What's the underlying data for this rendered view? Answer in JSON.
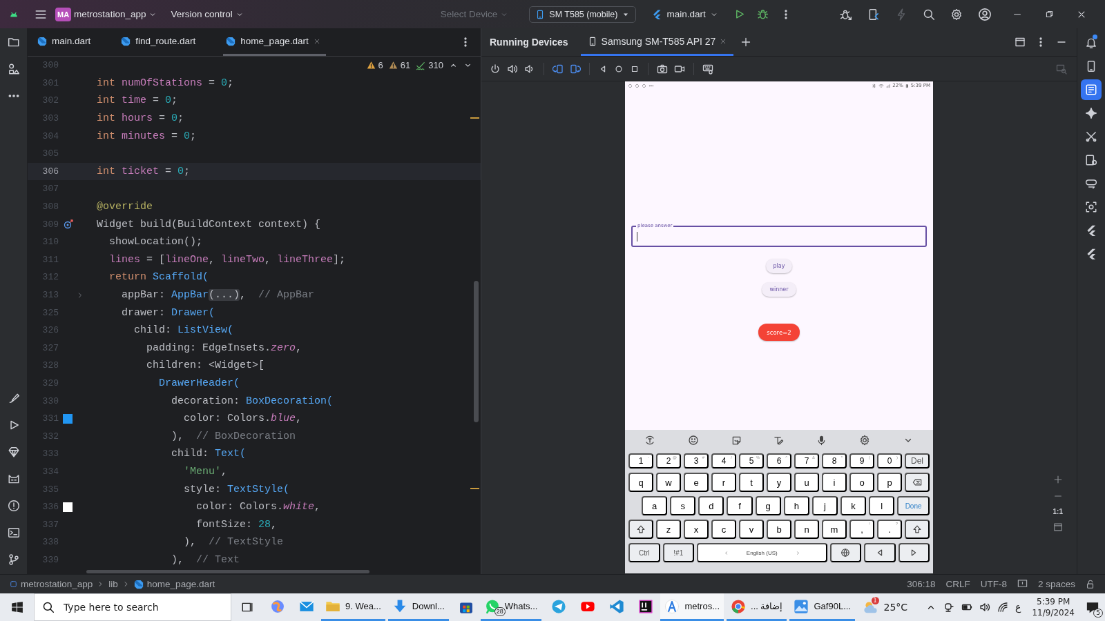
{
  "title_bar": {
    "project_badge": "MA",
    "project": "metrostation_app",
    "vcs": "Version control",
    "device_placeholder": "Select Device",
    "device": "SM T585 (mobile)",
    "run_config": "main.dart"
  },
  "editor": {
    "tabs": [
      {
        "label": "main.dart",
        "selected": false
      },
      {
        "label": "find_route.dart",
        "selected": false
      },
      {
        "label": "home_page.dart",
        "selected": true
      }
    ],
    "inspections": {
      "warnings": "6",
      "weak_warnings": "61",
      "typos": "310"
    },
    "lines": [
      {
        "number": "300",
        "kind": "plain",
        "current": false
      },
      {
        "number": "301",
        "kind": "plain",
        "current": false,
        "segments": [
          {
            "kind": "keyword",
            "text": "int"
          },
          {
            "kind": "field",
            "text": " numOfStations"
          },
          {
            "kind": "plain",
            "text": " = "
          },
          {
            "kind": "number",
            "text": "0"
          },
          {
            "kind": "plain",
            "text": ";"
          }
        ]
      },
      {
        "number": "302",
        "kind": "plain",
        "current": false,
        "segments": [
          {
            "kind": "keyword",
            "text": "int"
          },
          {
            "kind": "field",
            "text": " time"
          },
          {
            "kind": "plain",
            "text": " = "
          },
          {
            "kind": "number",
            "text": "0"
          },
          {
            "kind": "plain",
            "text": ";"
          }
        ]
      },
      {
        "number": "303",
        "kind": "plain",
        "current": false,
        "segments": [
          {
            "kind": "keyword",
            "text": "int"
          },
          {
            "kind": "field",
            "text": " hours"
          },
          {
            "kind": "plain",
            "text": " = "
          },
          {
            "kind": "number",
            "text": "0"
          },
          {
            "kind": "plain",
            "text": ";"
          }
        ]
      },
      {
        "number": "304",
        "kind": "plain",
        "current": false,
        "segments": [
          {
            "kind": "keyword",
            "text": "int"
          },
          {
            "kind": "field",
            "text": " minutes"
          },
          {
            "kind": "plain",
            "text": " = "
          },
          {
            "kind": "number",
            "text": "0"
          },
          {
            "kind": "plain",
            "text": ";"
          }
        ]
      },
      {
        "number": "305",
        "kind": "plain",
        "current": false
      },
      {
        "number": "306",
        "kind": "plain",
        "current": true,
        "segments": [
          {
            "kind": "keyword",
            "text": "int"
          },
          {
            "kind": "field",
            "text": " ticket"
          },
          {
            "kind": "plain",
            "text": " = "
          },
          {
            "kind": "number",
            "text": "0"
          },
          {
            "kind": "plain",
            "text": ";"
          }
        ]
      },
      {
        "number": "307",
        "kind": "plain",
        "current": false
      },
      {
        "number": "308",
        "kind": "plain",
        "current": false,
        "segments": [
          {
            "kind": "annotation",
            "text": "@override"
          }
        ]
      },
      {
        "number": "309",
        "kind": "override",
        "current": false,
        "segments": [
          {
            "kind": "plain",
            "text": "Widget build(BuildContext context) {"
          }
        ]
      },
      {
        "number": "310",
        "kind": "plain",
        "current": false,
        "segments": [
          {
            "kind": "plain",
            "text": "  showLocation();"
          }
        ]
      },
      {
        "number": "311",
        "kind": "plain",
        "current": false,
        "segments": [
          {
            "kind": "field",
            "text": "  lines"
          },
          {
            "kind": "plain",
            "text": " = ["
          },
          {
            "kind": "field",
            "text": "lineOne"
          },
          {
            "kind": "plain",
            "text": ", "
          },
          {
            "kind": "field",
            "text": "lineTwo"
          },
          {
            "kind": "plain",
            "text": ", "
          },
          {
            "kind": "field",
            "text": "lineThree"
          },
          {
            "kind": "plain",
            "text": "];"
          }
        ]
      },
      {
        "number": "312",
        "kind": "plain",
        "current": false,
        "segments": [
          {
            "kind": "keyword",
            "text": "  return"
          },
          {
            "kind": "call",
            "text": " Scaffold("
          }
        ]
      },
      {
        "number": "313",
        "kind": "fold",
        "current": false,
        "segments": [
          {
            "kind": "plain",
            "text": "    appBar: "
          },
          {
            "kind": "call",
            "text": "AppBar"
          },
          {
            "kind": "folded",
            "text": "(...)"
          },
          {
            "kind": "plain",
            "text": ",  "
          },
          {
            "kind": "comment",
            "text": "// AppBar"
          }
        ]
      },
      {
        "number": "325",
        "kind": "plain",
        "current": false,
        "segments": [
          {
            "kind": "plain",
            "text": "    drawer: "
          },
          {
            "kind": "call",
            "text": "Drawer("
          }
        ]
      },
      {
        "number": "326",
        "kind": "plain",
        "current": false,
        "segments": [
          {
            "kind": "plain",
            "text": "      child: "
          },
          {
            "kind": "call",
            "text": "ListView("
          }
        ]
      },
      {
        "number": "327",
        "kind": "plain",
        "current": false,
        "segments": [
          {
            "kind": "plain",
            "text": "        padding: EdgeInsets."
          },
          {
            "kind": "constant",
            "text": "zero"
          },
          {
            "kind": "plain",
            "text": ","
          }
        ]
      },
      {
        "number": "328",
        "kind": "plain",
        "current": false,
        "segments": [
          {
            "kind": "plain",
            "text": "        children: <Widget>["
          }
        ]
      },
      {
        "number": "329",
        "kind": "plain",
        "current": false,
        "segments": [
          {
            "kind": "call",
            "text": "          DrawerHeader("
          }
        ]
      },
      {
        "number": "330",
        "kind": "plain",
        "current": false,
        "segments": [
          {
            "kind": "plain",
            "text": "            decoration: "
          },
          {
            "kind": "call",
            "text": "BoxDecoration("
          }
        ]
      },
      {
        "number": "331",
        "kind": "swatch",
        "color": "#2196f3",
        "current": false,
        "segments": [
          {
            "kind": "plain",
            "text": "              color: Colors."
          },
          {
            "kind": "constant",
            "text": "blue"
          },
          {
            "kind": "plain",
            "text": ","
          }
        ]
      },
      {
        "number": "332",
        "kind": "plain",
        "current": false,
        "segments": [
          {
            "kind": "plain",
            "text": "            ),  "
          },
          {
            "kind": "comment",
            "text": "// BoxDecoration"
          }
        ]
      },
      {
        "number": "333",
        "kind": "plain",
        "current": false,
        "segments": [
          {
            "kind": "plain",
            "text": "            child: "
          },
          {
            "kind": "call",
            "text": "Text("
          }
        ]
      },
      {
        "number": "334",
        "kind": "plain",
        "current": false,
        "segments": [
          {
            "kind": "string",
            "text": "              'Menu'"
          },
          {
            "kind": "plain",
            "text": ","
          }
        ]
      },
      {
        "number": "335",
        "kind": "plain",
        "current": false,
        "segments": [
          {
            "kind": "plain",
            "text": "              style: "
          },
          {
            "kind": "call",
            "text": "TextStyle("
          }
        ]
      },
      {
        "number": "336",
        "kind": "swatch",
        "color": "#ffffff",
        "current": false,
        "segments": [
          {
            "kind": "plain",
            "text": "                color: Colors."
          },
          {
            "kind": "constant",
            "text": "white"
          },
          {
            "kind": "plain",
            "text": ","
          }
        ]
      },
      {
        "number": "337",
        "kind": "plain",
        "current": false,
        "segments": [
          {
            "kind": "plain",
            "text": "                fontSize: "
          },
          {
            "kind": "number",
            "text": "28"
          },
          {
            "kind": "plain",
            "text": ","
          }
        ]
      },
      {
        "number": "338",
        "kind": "plain",
        "current": false,
        "segments": [
          {
            "kind": "plain",
            "text": "              ),  "
          },
          {
            "kind": "comment",
            "text": "// TextStyle"
          }
        ]
      },
      {
        "number": "339",
        "kind": "plain",
        "current": false,
        "segments": [
          {
            "kind": "plain",
            "text": "            ),  "
          },
          {
            "kind": "comment",
            "text": "// Text"
          }
        ]
      }
    ]
  },
  "running_devices": {
    "title": "Running Devices",
    "tabs": [
      {
        "label": "Samsung SM-T585 API 27",
        "selected": true
      }
    ],
    "zoom_reset": "1:1"
  },
  "phone": {
    "battery": "22%",
    "time": "5:39 PM",
    "field": {
      "label": "please answer",
      "focused": true
    },
    "buttons": [
      {
        "label": "play",
        "kind": "tonal"
      },
      {
        "label": "winner",
        "kind": "tonal"
      },
      {
        "label": "score=2",
        "kind": "alert"
      }
    ],
    "keyboard": [
      [
        {
          "kind": "char",
          "label": "1",
          "alt": "-"
        },
        {
          "kind": "char",
          "label": "2",
          "alt": "@"
        },
        {
          "kind": "char",
          "label": "3",
          "alt": "#"
        },
        {
          "kind": "char",
          "label": "4",
          "alt": "/"
        },
        {
          "kind": "char",
          "label": "5",
          "alt": "%"
        },
        {
          "kind": "char",
          "label": "6",
          "alt": "^"
        },
        {
          "kind": "char",
          "label": "7",
          "alt": "&"
        },
        {
          "kind": "char",
          "label": "8",
          "alt": "*"
        },
        {
          "kind": "char",
          "label": "9",
          "alt": "("
        },
        {
          "kind": "char",
          "label": "0",
          "alt": ")"
        },
        {
          "kind": "fn",
          "label": "Del"
        }
      ],
      [
        {
          "kind": "char",
          "label": "q"
        },
        {
          "kind": "char",
          "label": "w"
        },
        {
          "kind": "char",
          "label": "e"
        },
        {
          "kind": "char",
          "label": "r"
        },
        {
          "kind": "char",
          "label": "t"
        },
        {
          "kind": "char",
          "label": "y"
        },
        {
          "kind": "char",
          "label": "u"
        },
        {
          "kind": "char",
          "label": "i"
        },
        {
          "kind": "char",
          "label": "o"
        },
        {
          "kind": "char",
          "label": "p"
        },
        {
          "kind": "backspace"
        }
      ],
      [
        {
          "kind": "char",
          "label": "a"
        },
        {
          "kind": "char",
          "label": "s"
        },
        {
          "kind": "char",
          "label": "d"
        },
        {
          "kind": "char",
          "label": "f"
        },
        {
          "kind": "char",
          "label": "g"
        },
        {
          "kind": "char",
          "label": "h"
        },
        {
          "kind": "char",
          "label": "j"
        },
        {
          "kind": "char",
          "label": "k"
        },
        {
          "kind": "char",
          "label": "l"
        },
        {
          "kind": "done",
          "label": "Done"
        }
      ],
      [
        {
          "kind": "shift"
        },
        {
          "kind": "char",
          "label": "z"
        },
        {
          "kind": "char",
          "label": "x"
        },
        {
          "kind": "char",
          "label": "c"
        },
        {
          "kind": "char",
          "label": "v"
        },
        {
          "kind": "char",
          "label": "b"
        },
        {
          "kind": "char",
          "label": "n"
        },
        {
          "kind": "char",
          "label": "m"
        },
        {
          "kind": "char",
          "label": ",",
          "alt": "!"
        },
        {
          "kind": "char",
          "label": ".",
          "alt": "?"
        },
        {
          "kind": "shift"
        }
      ],
      [
        {
          "kind": "fn",
          "label": "Ctrl"
        },
        {
          "kind": "fn",
          "label": "!#1"
        },
        {
          "kind": "space",
          "label": "English (US)"
        },
        {
          "kind": "globe"
        },
        {
          "kind": "left"
        },
        {
          "kind": "right"
        }
      ]
    ]
  },
  "right_tools": [
    {
      "kind": "bell",
      "selected": false,
      "badge": true
    },
    {
      "kind": "device",
      "selected": false,
      "badge": false
    },
    {
      "kind": "running",
      "selected": true,
      "badge": false
    },
    {
      "kind": "sparkle",
      "selected": false,
      "badge": false
    },
    {
      "kind": "tools",
      "selected": false,
      "badge": false
    },
    {
      "kind": "device_gear",
      "selected": false,
      "badge": false
    },
    {
      "kind": "link",
      "selected": false,
      "badge": false
    },
    {
      "kind": "frame",
      "selected": false,
      "badge": false
    },
    {
      "kind": "flutter",
      "selected": false,
      "badge": false
    },
    {
      "kind": "flutter",
      "selected": false,
      "badge": false
    }
  ],
  "status_bar": {
    "path": [
      {
        "label": "metrostation_app",
        "kind": "module"
      },
      {
        "label": "lib",
        "kind": "folder"
      },
      {
        "label": "home_page.dart",
        "kind": "file"
      }
    ],
    "position": "306:18",
    "line_separator": "CRLF",
    "encoding": "UTF-8",
    "indent": "2 spaces"
  },
  "taskbar": {
    "search_placeholder": "Type here to search",
    "apps": [
      {
        "kind": "copilot",
        "running": false,
        "selected": false
      },
      {
        "kind": "mail",
        "running": false,
        "selected": false
      },
      {
        "kind": "folder",
        "label": "9. Wea...",
        "running": true,
        "selected": false
      },
      {
        "kind": "download",
        "label": "Downl...",
        "running": true,
        "selected": false
      },
      {
        "kind": "store",
        "running": false,
        "selected": false
      },
      {
        "kind": "chat",
        "label": "Whats...",
        "badge": "28",
        "running": true,
        "selected": false
      },
      {
        "kind": "plane",
        "running": false,
        "selected": false
      },
      {
        "kind": "video",
        "running": false,
        "selected": false
      },
      {
        "kind": "code",
        "running": false,
        "selected": false
      },
      {
        "kind": "ide",
        "running": false,
        "selected": false
      },
      {
        "kind": "studio",
        "label": "metros...",
        "running": true,
        "selected": true
      },
      {
        "kind": "browser",
        "label": "إضافة ...",
        "running": true,
        "selected": false
      },
      {
        "kind": "photos",
        "label": "Gaf90L...",
        "running": true,
        "selected": false
      }
    ],
    "weather": {
      "temperature": "25°C",
      "badge": "1"
    },
    "language": "ع",
    "time": "5:39 PM",
    "date": "11/9/2024",
    "notifications": "5"
  }
}
